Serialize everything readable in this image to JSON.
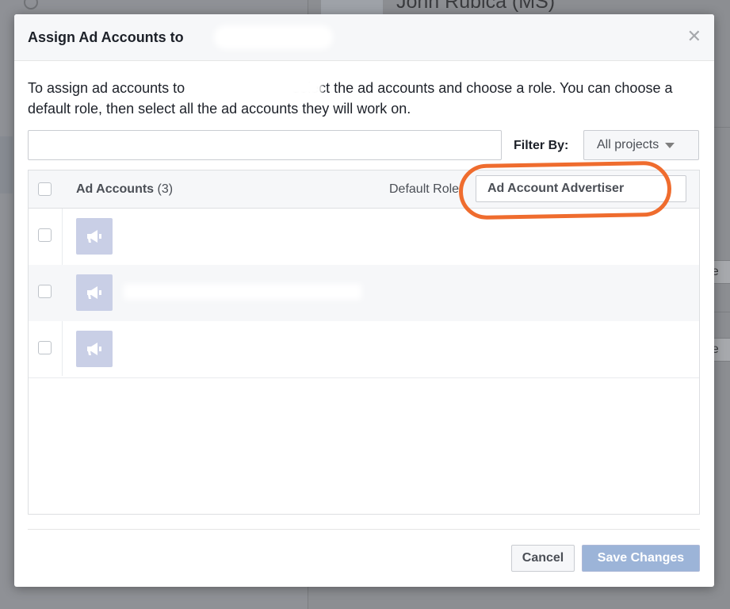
{
  "background": {
    "header_name": "John Rublca (MS)",
    "peek_button_text": "ge"
  },
  "modal": {
    "title": "Assign Ad Accounts to",
    "intro_part1": "To assign ad accounts to",
    "intro_part2": "select the ad accounts and choose a role. You can choose a default role, then select all the ad accounts they will work on.",
    "search": {
      "value": "",
      "placeholder": ""
    },
    "filter_label": "Filter By:",
    "filter_value": "All projects",
    "table": {
      "header_label": "Ad Accounts",
      "header_count": "(3)",
      "default_role_label": "Default Role:",
      "default_role_value": "Ad Account Advertiser",
      "rows": [
        {
          "name": ""
        },
        {
          "name": ""
        },
        {
          "name": ""
        }
      ]
    },
    "buttons": {
      "cancel": "Cancel",
      "save": "Save Changes"
    }
  },
  "colors": {
    "highlight": "#ef6c2e",
    "save_disabled": "#9cb4d8",
    "account_icon": "#c9cfe6"
  }
}
